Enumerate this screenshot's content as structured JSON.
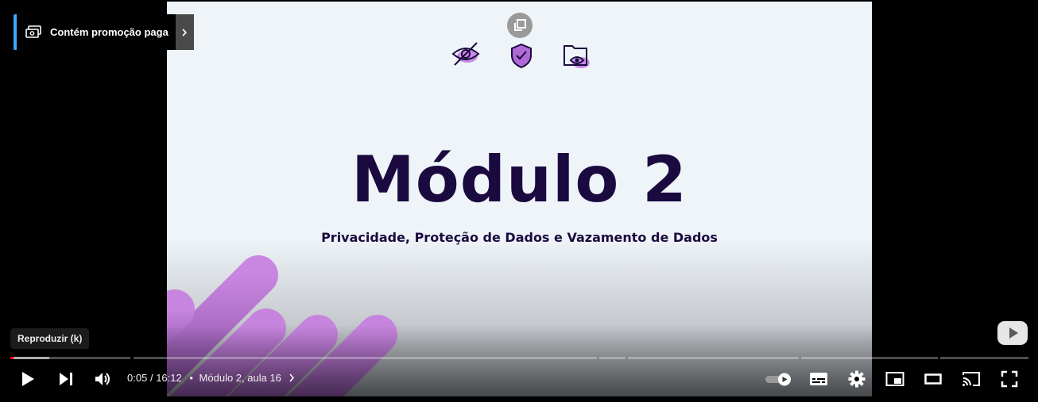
{
  "promo": {
    "label": "Contém promoção paga"
  },
  "slide": {
    "title": "Módulo 2",
    "subtitle": "Privacidade, Proteção de Dados e Vazamento de Dados",
    "icons": [
      "eye-slash-icon",
      "shield-check-icon",
      "folder-eye-icon"
    ]
  },
  "tooltip": {
    "label": "Reproduzir (k)"
  },
  "player": {
    "time_current": "0:05",
    "time_separator": "/",
    "time_total": "16:12",
    "chapter": "Módulo 2, aula 16",
    "progress_played": 0.003,
    "progress_loaded": 0.038
  },
  "colors": {
    "title": "#1a0a3f",
    "accent_promo": "#3ea6ff",
    "progress_played": "#ff0000",
    "slide_purple": "#b06ad6"
  }
}
